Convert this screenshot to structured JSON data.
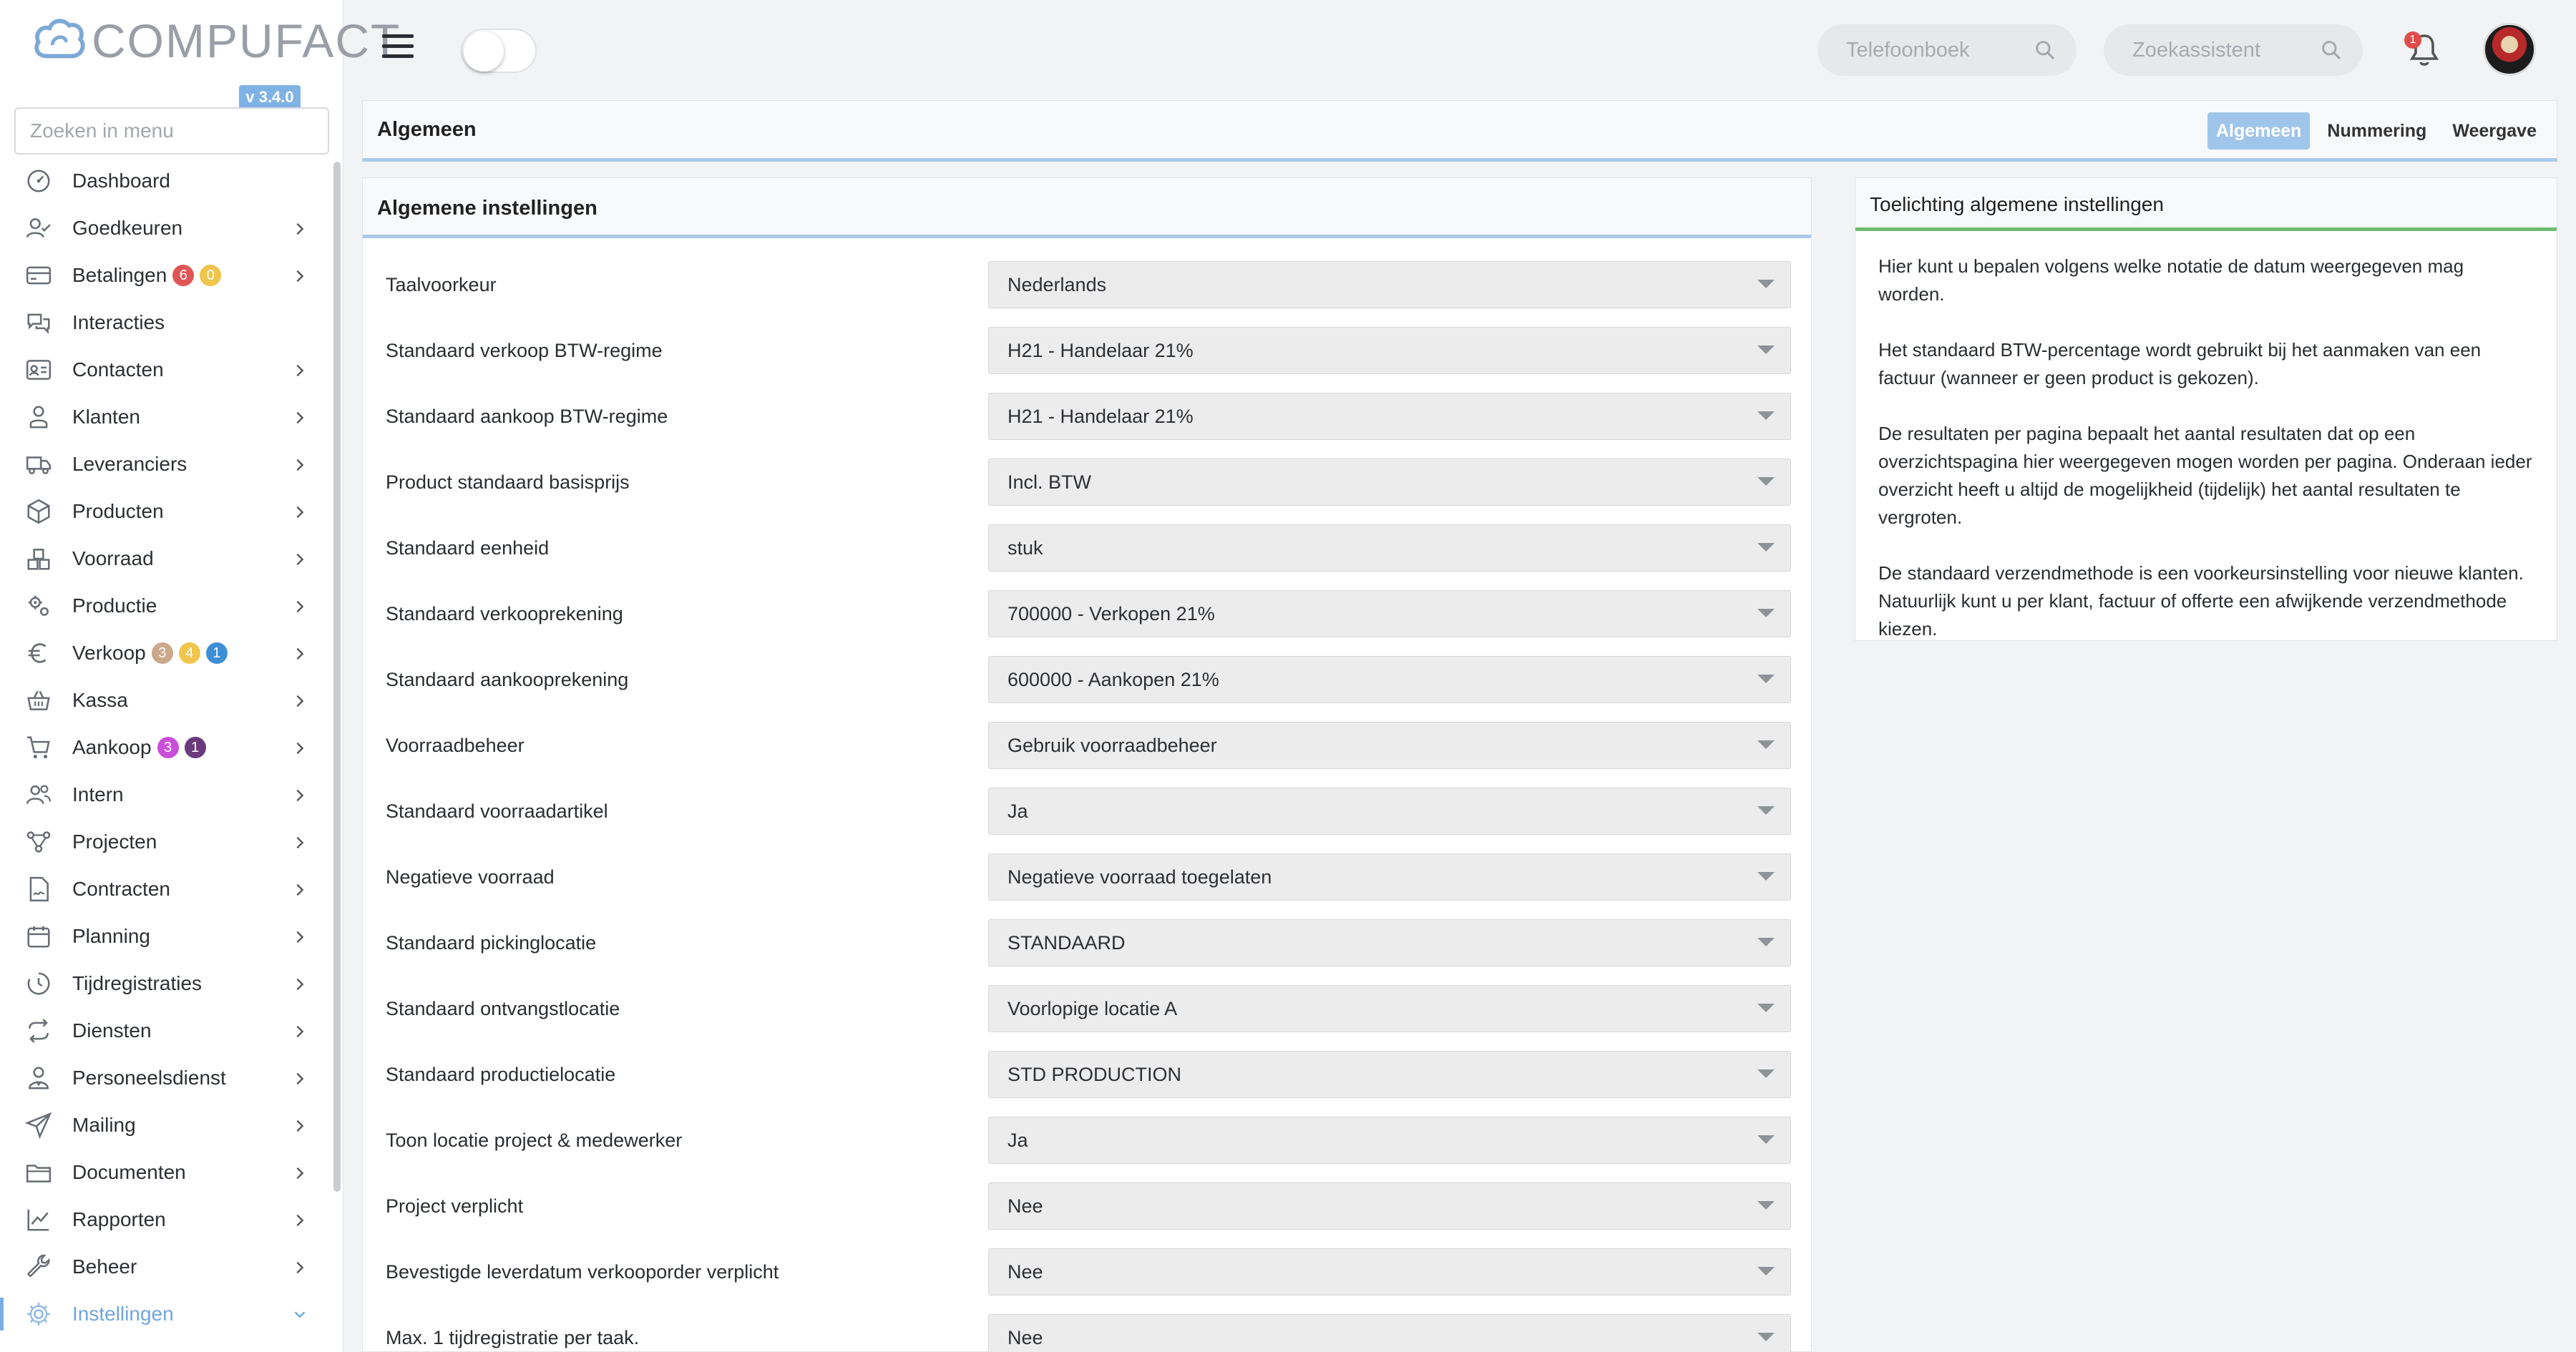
{
  "app": {
    "name": "COMPUFACT",
    "version": "v 3.4.0"
  },
  "sidebar": {
    "search_placeholder": "Zoeken in menu",
    "items": [
      {
        "label": "Dashboard",
        "icon": "dashboard-icon",
        "has_children": false,
        "badges": []
      },
      {
        "label": "Goedkeuren",
        "icon": "user-check-icon",
        "has_children": true,
        "badges": []
      },
      {
        "label": "Betalingen",
        "icon": "credit-card-icon",
        "has_children": true,
        "badges": [
          {
            "value": "6",
            "color": "#e05555"
          },
          {
            "value": "0",
            "color": "#f0c54c"
          }
        ]
      },
      {
        "label": "Interacties",
        "icon": "chat-bubbles-icon",
        "has_children": false,
        "badges": []
      },
      {
        "label": "Contacten",
        "icon": "contact-card-icon",
        "has_children": true,
        "badges": []
      },
      {
        "label": "Klanten",
        "icon": "customer-icon",
        "has_children": true,
        "badges": []
      },
      {
        "label": "Leveranciers",
        "icon": "truck-icon",
        "has_children": true,
        "badges": []
      },
      {
        "label": "Producten",
        "icon": "box-icon",
        "has_children": true,
        "badges": []
      },
      {
        "label": "Voorraad",
        "icon": "boxes-icon",
        "has_children": true,
        "badges": []
      },
      {
        "label": "Productie",
        "icon": "gears-icon",
        "has_children": true,
        "badges": []
      },
      {
        "label": "Verkoop",
        "icon": "euro-icon",
        "has_children": true,
        "badges": [
          {
            "value": "3",
            "color": "#c9a98a"
          },
          {
            "value": "4",
            "color": "#f0c54c"
          },
          {
            "value": "1",
            "color": "#3d8fd6"
          }
        ]
      },
      {
        "label": "Kassa",
        "icon": "basket-icon",
        "has_children": true,
        "badges": []
      },
      {
        "label": "Aankoop",
        "icon": "cart-icon",
        "has_children": true,
        "badges": [
          {
            "value": "3",
            "color": "#c94fd8"
          },
          {
            "value": "1",
            "color": "#6b3a7e"
          }
        ]
      },
      {
        "label": "Intern",
        "icon": "users-icon",
        "has_children": true,
        "badges": []
      },
      {
        "label": "Projecten",
        "icon": "project-tree-icon",
        "has_children": true,
        "badges": []
      },
      {
        "label": "Contracten",
        "icon": "contract-icon",
        "has_children": true,
        "badges": []
      },
      {
        "label": "Planning",
        "icon": "calendar-icon",
        "has_children": true,
        "badges": []
      },
      {
        "label": "Tijdregistraties",
        "icon": "clock-icon",
        "has_children": true,
        "badges": []
      },
      {
        "label": "Diensten",
        "icon": "repeat-icon",
        "has_children": true,
        "badges": []
      },
      {
        "label": "Personeelsdienst",
        "icon": "staff-icon",
        "has_children": true,
        "badges": []
      },
      {
        "label": "Mailing",
        "icon": "paper-plane-icon",
        "has_children": true,
        "badges": []
      },
      {
        "label": "Documenten",
        "icon": "folder-icon",
        "has_children": true,
        "badges": []
      },
      {
        "label": "Rapporten",
        "icon": "line-chart-icon",
        "has_children": true,
        "badges": []
      },
      {
        "label": "Beheer",
        "icon": "wrench-icon",
        "has_children": true,
        "badges": []
      },
      {
        "label": "Instellingen",
        "icon": "gear-icon",
        "has_children": true,
        "badges": [],
        "active": true
      }
    ]
  },
  "topbar": {
    "phonebook_placeholder": "Telefoonboek",
    "assistant_placeholder": "Zoekassistent",
    "notification_count": "1"
  },
  "breadcrumb": {
    "title": "Algemeen",
    "tabs": [
      {
        "label": "Algemeen",
        "active": true
      },
      {
        "label": "Nummering",
        "active": false
      },
      {
        "label": "Weergave",
        "active": false
      }
    ]
  },
  "settings": {
    "title": "Algemene instellingen",
    "rows": [
      {
        "label": "Taalvoorkeur",
        "value": "Nederlands"
      },
      {
        "label": "Standaard verkoop BTW-regime",
        "value": "H21 - Handelaar 21%"
      },
      {
        "label": "Standaard aankoop BTW-regime",
        "value": "H21 - Handelaar 21%"
      },
      {
        "label": "Product standaard basisprijs",
        "value": "Incl. BTW"
      },
      {
        "label": "Standaard eenheid",
        "value": "stuk"
      },
      {
        "label": "Standaard verkooprekening",
        "value": "700000 - Verkopen 21%"
      },
      {
        "label": "Standaard aankooprekening",
        "value": "600000 - Aankopen 21%"
      },
      {
        "label": "Voorraadbeheer",
        "value": "Gebruik voorraadbeheer"
      },
      {
        "label": "Standaard voorraadartikel",
        "value": "Ja"
      },
      {
        "label": "Negatieve voorraad",
        "value": "Negatieve voorraad toegelaten"
      },
      {
        "label": "Standaard pickinglocatie",
        "value": "STANDAARD"
      },
      {
        "label": "Standaard ontvangstlocatie",
        "value": "Voorlopige locatie A"
      },
      {
        "label": "Standaard productielocatie",
        "value": "STD PRODUCTION"
      },
      {
        "label": "Toon locatie project & medewerker",
        "value": "Ja"
      },
      {
        "label": "Project verplicht",
        "value": "Nee"
      },
      {
        "label": "Bevestigde leverdatum verkooporder verplicht",
        "value": "Nee"
      },
      {
        "label": "Max. 1 tijdregistratie per taak.",
        "value": "Nee"
      }
    ]
  },
  "info": {
    "title": "Toelichting algemene instellingen",
    "paragraphs": [
      "Hier kunt u bepalen volgens welke notatie de datum weergegeven mag worden.",
      "Het standaard BTW-percentage wordt gebruikt bij het aanmaken van een factuur (wanneer er geen product is gekozen).",
      "De resultaten per pagina bepaalt het aantal resultaten dat op een overzichtspagina hier weergegeven mogen worden per pagina. Onderaan ieder overzicht heeft u altijd de mogelijkheid (tijdelijk) het aantal resultaten te vergroten.",
      "De standaard verzendmethode is een voorkeursinstelling voor nieuwe klanten. Natuurlijk kunt u per klant, factuur of offerte een afwijkende verzendmethode kiezen."
    ]
  }
}
